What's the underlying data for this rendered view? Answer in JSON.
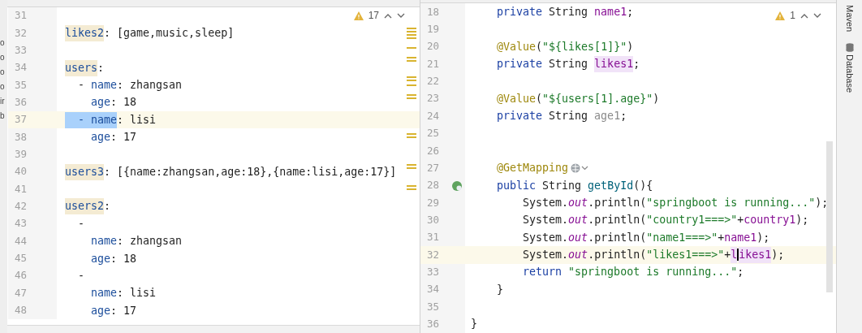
{
  "project_tree_fragments": [
    "o",
    "o",
    "o",
    "o",
    "ir",
    "b"
  ],
  "left_editor": {
    "warning_count": "17",
    "lines": [
      {
        "number": "31",
        "current": false
      },
      {
        "number": "32",
        "current": false,
        "tokens": [
          {
            "text": "likes2",
            "kind": "key-marked"
          },
          {
            "text": ": [game,music,sleep]",
            "kind": "text"
          }
        ]
      },
      {
        "number": "33",
        "current": false
      },
      {
        "number": "34",
        "current": false,
        "tokens": [
          {
            "text": "users",
            "kind": "key-marked"
          },
          {
            "text": ":",
            "kind": "text"
          }
        ]
      },
      {
        "number": "35",
        "current": false,
        "tokens": [
          {
            "text": "  - ",
            "kind": "text"
          },
          {
            "text": "name",
            "kind": "key"
          },
          {
            "text": ": zhangsan",
            "kind": "text"
          }
        ]
      },
      {
        "number": "36",
        "current": false,
        "tokens": [
          {
            "text": "    age",
            "kind": "key"
          },
          {
            "text": ": 18",
            "kind": "text"
          }
        ]
      },
      {
        "number": "37",
        "current": true,
        "tokens": [
          {
            "text": "  - name",
            "kind": "selection"
          },
          {
            "text": ": lisi",
            "kind": "text"
          }
        ]
      },
      {
        "number": "38",
        "current": false,
        "tokens": [
          {
            "text": "    age",
            "kind": "key"
          },
          {
            "text": ": 17",
            "kind": "text"
          }
        ]
      },
      {
        "number": "39",
        "current": false
      },
      {
        "number": "40",
        "current": false,
        "tokens": [
          {
            "text": "users3",
            "kind": "key-marked"
          },
          {
            "text": ": [{name:zhangsan,age:18},{name:lisi,age:17}]",
            "kind": "text"
          }
        ]
      },
      {
        "number": "41",
        "current": false
      },
      {
        "number": "42",
        "current": false,
        "tokens": [
          {
            "text": "users2",
            "kind": "key-marked"
          },
          {
            "text": ":",
            "kind": "text"
          }
        ]
      },
      {
        "number": "43",
        "current": false,
        "tokens": [
          {
            "text": "  -",
            "kind": "text"
          }
        ]
      },
      {
        "number": "44",
        "current": false,
        "tokens": [
          {
            "text": "    name",
            "kind": "key"
          },
          {
            "text": ": zhangsan",
            "kind": "text"
          }
        ]
      },
      {
        "number": "45",
        "current": false,
        "tokens": [
          {
            "text": "    age",
            "kind": "key"
          },
          {
            "text": ": 18",
            "kind": "text"
          }
        ]
      },
      {
        "number": "46",
        "current": false,
        "tokens": [
          {
            "text": "  -",
            "kind": "text"
          }
        ]
      },
      {
        "number": "47",
        "current": false,
        "tokens": [
          {
            "text": "    name",
            "kind": "key"
          },
          {
            "text": ": lisi",
            "kind": "text"
          }
        ]
      },
      {
        "number": "48",
        "current": false,
        "tokens": [
          {
            "text": "    age",
            "kind": "key"
          },
          {
            "text": ": 17",
            "kind": "text"
          }
        ]
      }
    ]
  },
  "right_editor": {
    "warning_count": "1",
    "lines": [
      {
        "number": "18",
        "current": false,
        "tokens": [
          {
            "text": "    private",
            "kind": "keyword"
          },
          {
            "text": " String ",
            "kind": "text"
          },
          {
            "text": "name1",
            "kind": "field"
          },
          {
            "text": ";",
            "kind": "text"
          }
        ]
      },
      {
        "number": "19",
        "current": false
      },
      {
        "number": "20",
        "current": false,
        "tokens": [
          {
            "text": "    @Value",
            "kind": "annotation"
          },
          {
            "text": "(",
            "kind": "text"
          },
          {
            "text": "\"${likes[1]}\"",
            "kind": "string"
          },
          {
            "text": ")",
            "kind": "text"
          }
        ]
      },
      {
        "number": "21",
        "current": false,
        "tokens": [
          {
            "text": "    private",
            "kind": "keyword"
          },
          {
            "text": " String ",
            "kind": "text"
          },
          {
            "text": "likes1",
            "kind": "field-marked"
          },
          {
            "text": ";",
            "kind": "text"
          }
        ]
      },
      {
        "number": "22",
        "current": false
      },
      {
        "number": "23",
        "current": false,
        "tokens": [
          {
            "text": "    @Value",
            "kind": "annotation"
          },
          {
            "text": "(",
            "kind": "text"
          },
          {
            "text": "\"${users[1].age}\"",
            "kind": "string"
          },
          {
            "text": ")",
            "kind": "text"
          }
        ]
      },
      {
        "number": "24",
        "current": false,
        "tokens": [
          {
            "text": "    private",
            "kind": "keyword"
          },
          {
            "text": " String ",
            "kind": "text"
          },
          {
            "text": "age1",
            "kind": "unused"
          },
          {
            "text": ";",
            "kind": "text"
          }
        ]
      },
      {
        "number": "25",
        "current": false
      },
      {
        "number": "26",
        "current": false
      },
      {
        "number": "27",
        "current": false,
        "tokens": [
          {
            "text": "    @GetMapping",
            "kind": "annotation"
          },
          {
            "kind": "globe"
          }
        ]
      },
      {
        "number": "28",
        "current": false,
        "run_icon": true,
        "tokens": [
          {
            "text": "    public",
            "kind": "keyword"
          },
          {
            "text": " String ",
            "kind": "text"
          },
          {
            "text": "getById",
            "kind": "method"
          },
          {
            "text": "(){",
            "kind": "text"
          }
        ]
      },
      {
        "number": "29",
        "current": false,
        "tokens": [
          {
            "text": "        System.",
            "kind": "text"
          },
          {
            "text": "out",
            "kind": "static"
          },
          {
            "text": ".println(",
            "kind": "text"
          },
          {
            "text": "\"springboot is running...\"",
            "kind": "string"
          },
          {
            "text": ");",
            "kind": "text"
          }
        ]
      },
      {
        "number": "30",
        "current": false,
        "tokens": [
          {
            "text": "        System.",
            "kind": "text"
          },
          {
            "text": "out",
            "kind": "static"
          },
          {
            "text": ".println(",
            "kind": "text"
          },
          {
            "text": "\"country1===>\"",
            "kind": "string"
          },
          {
            "text": "+",
            "kind": "text"
          },
          {
            "text": "country1",
            "kind": "field"
          },
          {
            "text": ");",
            "kind": "text"
          }
        ]
      },
      {
        "number": "31",
        "current": false,
        "tokens": [
          {
            "text": "        System.",
            "kind": "text"
          },
          {
            "text": "out",
            "kind": "static"
          },
          {
            "text": ".println(",
            "kind": "text"
          },
          {
            "text": "\"name1===>\"",
            "kind": "string"
          },
          {
            "text": "+",
            "kind": "text"
          },
          {
            "text": "name1",
            "kind": "field"
          },
          {
            "text": ");",
            "kind": "text"
          }
        ]
      },
      {
        "number": "32",
        "current": true,
        "tokens": [
          {
            "text": "        System.",
            "kind": "text"
          },
          {
            "text": "out",
            "kind": "static"
          },
          {
            "text": ".println(",
            "kind": "text"
          },
          {
            "text": "\"likes1===>\"",
            "kind": "string"
          },
          {
            "text": "+",
            "kind": "text"
          },
          {
            "text": "l",
            "kind": "field-marked"
          },
          {
            "kind": "caret"
          },
          {
            "text": "ikes1",
            "kind": "field-marked"
          },
          {
            "text": ");",
            "kind": "text"
          }
        ]
      },
      {
        "number": "33",
        "current": false,
        "tokens": [
          {
            "text": "        return",
            "kind": "keyword"
          },
          {
            "text": " \"springboot is running...\"",
            "kind": "string"
          },
          {
            "text": ";",
            "kind": "text"
          }
        ]
      },
      {
        "number": "34",
        "current": false,
        "tokens": [
          {
            "text": "    }",
            "kind": "text"
          }
        ]
      },
      {
        "number": "35",
        "current": false
      },
      {
        "number": "36",
        "current": false,
        "tokens": [
          {
            "text": "}",
            "kind": "text"
          }
        ]
      }
    ]
  },
  "tool_window_tabs": [
    "Maven",
    "Database"
  ]
}
